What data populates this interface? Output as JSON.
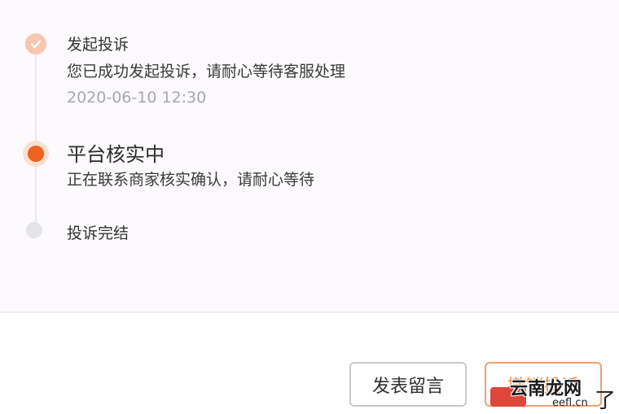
{
  "timeline": {
    "steps": [
      {
        "title": "发起投诉",
        "description": "您已成功发起投诉，请耐心等待客服处理",
        "time": "2020-06-10 12:30",
        "status": "done"
      },
      {
        "title": "平台核实中",
        "description": "正在联系商家核实确认，请耐心等待",
        "status": "active"
      },
      {
        "title": "投诉完结",
        "status": "pending"
      }
    ]
  },
  "actions": {
    "leave_message": "发表留言",
    "withdraw": "撤销投诉"
  },
  "watermark": {
    "site": "云南龙网",
    "url": "eefl.cn",
    "extra": "了"
  },
  "colors": {
    "accent": "#f0601f",
    "done_dot": "#f9c6ae",
    "pending_dot": "#e4e4e7",
    "withdraw_border": "#f0a06f"
  }
}
